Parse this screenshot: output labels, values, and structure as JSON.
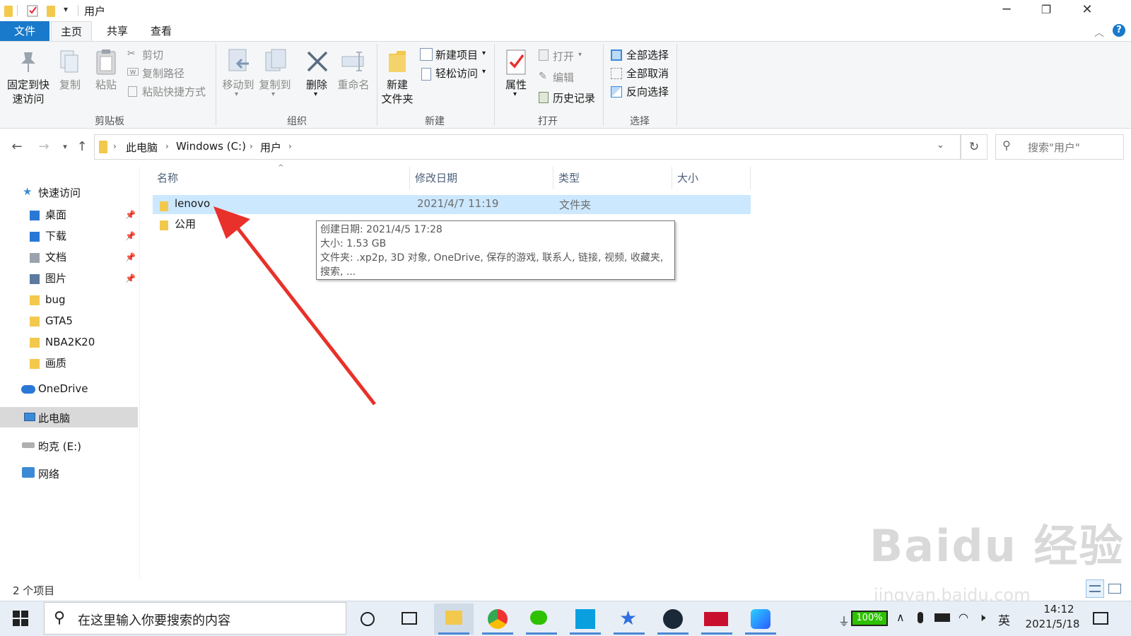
{
  "window": {
    "title": "用户",
    "minimize": "─",
    "restore": "❐",
    "close": "✕",
    "help": "?"
  },
  "ribbon_tabs": [
    "文件",
    "主页",
    "共享",
    "查看"
  ],
  "ribbon": {
    "clipboard": {
      "pin": "固定到快\n速访问",
      "copy": "复制",
      "paste": "粘贴",
      "cut": "剪切",
      "copy_path": "复制路径",
      "paste_shortcut": "粘贴快捷方式",
      "label": "剪贴板"
    },
    "organize": {
      "move_to": "移动到",
      "copy_to": "复制到",
      "delete": "删除",
      "rename": "重命名",
      "label": "组织"
    },
    "new": {
      "new_folder": "新建\n文件夹",
      "new_item": "新建项目",
      "easy_access": "轻松访问",
      "label": "新建"
    },
    "open": {
      "properties": "属性",
      "open": "打开",
      "edit": "编辑",
      "history": "历史记录",
      "label": "打开"
    },
    "select": {
      "select_all": "全部选择",
      "select_none": "全部取消",
      "invert": "反向选择",
      "label": "选择"
    }
  },
  "address": {
    "crumbs": [
      "此电脑",
      "Windows (C:)",
      "用户"
    ],
    "search_placeholder": "搜索\"用户\""
  },
  "nav": {
    "quick_access": "快速访问",
    "items": [
      {
        "label": "桌面",
        "pinned": true,
        "icon": "desktop-icon"
      },
      {
        "label": "下载",
        "pinned": true,
        "icon": "download-icon"
      },
      {
        "label": "文档",
        "pinned": true,
        "icon": "document-icon"
      },
      {
        "label": "图片",
        "pinned": true,
        "icon": "picture-icon"
      },
      {
        "label": "bug",
        "pinned": false,
        "icon": "folder-icon"
      },
      {
        "label": "GTA5",
        "pinned": false,
        "icon": "folder-icon"
      },
      {
        "label": "NBA2K20",
        "pinned": false,
        "icon": "folder-icon"
      },
      {
        "label": "画质",
        "pinned": false,
        "icon": "folder-icon"
      }
    ],
    "onedrive": "OneDrive",
    "this_pc": "此电脑",
    "drive_e": "昀克 (E:)",
    "network": "网络"
  },
  "columns": {
    "name": "名称",
    "modified": "修改日期",
    "type": "类型",
    "size": "大小"
  },
  "files": [
    {
      "name": "lenovo",
      "modified": "2021/4/7 11:19",
      "type": "文件夹",
      "selected": true
    },
    {
      "name": "公用",
      "modified": "",
      "type": "",
      "selected": false
    }
  ],
  "tooltip": {
    "created": "创建日期: 2021/4/5 17:28",
    "size": "大小: 1.53 GB",
    "folders": "文件夹: .xp2p, 3D 对象, OneDrive, 保存的游戏, 联系人, 链接, 视频, 收藏夹,",
    "more": "搜索, ..."
  },
  "status": {
    "count": "2 个项目"
  },
  "taskbar": {
    "search_placeholder": "在这里输入你要搜索的内容",
    "battery": "100%",
    "ime": "英",
    "time": "14:12",
    "date": "2021/5/18"
  },
  "watermark": {
    "logo": "Baidu 经验",
    "url": "jingyan.baidu.com"
  },
  "colors": {
    "accent": "#1979ca",
    "selection": "#cce8ff",
    "arrow": "#e8312a"
  }
}
